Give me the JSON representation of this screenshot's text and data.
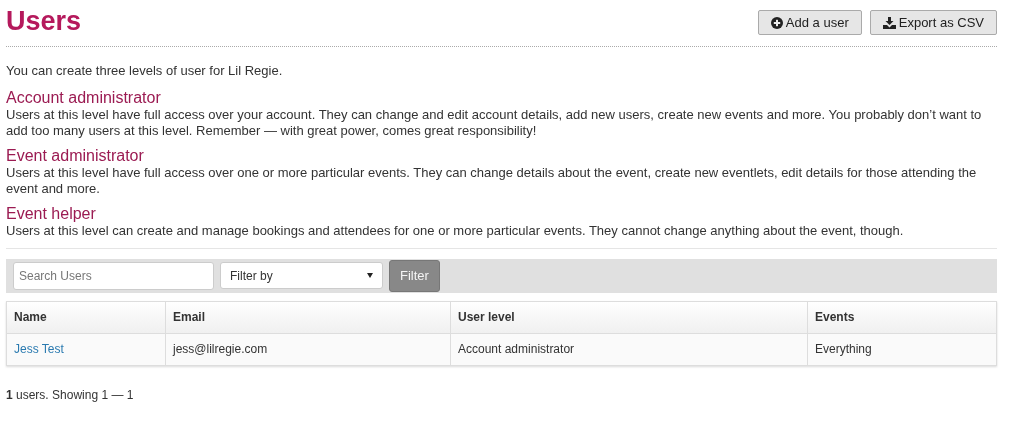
{
  "header": {
    "title": "Users",
    "buttons": [
      {
        "kind": "add",
        "label": "Add a user"
      },
      {
        "kind": "export",
        "label": "Export as CSV"
      }
    ]
  },
  "intro": "You can create three levels of user for Lil Regie.",
  "levels": [
    {
      "title": "Account administrator",
      "text": "Users at this level have full access over your account. They can change and edit account details, add new users, create new events and more. You probably don’t want to add too many users at this level. Remember — with great power, comes great responsibility!"
    },
    {
      "title": "Event administrator",
      "text": "Users at this level have full access over one or more particular events. They can change details about the event, create new eventlets, edit details for those attending the event and more."
    },
    {
      "title": "Event helper",
      "text": "Users at this level can create and manage bookings and attendees for one or more particular events. They cannot change anything about the event, though."
    }
  ],
  "filter_bar": {
    "search": {
      "placeholder": "Search Users"
    },
    "select": {
      "value": "Filter by"
    },
    "button": {
      "label": "Filter",
      "disabled": true
    }
  },
  "table": {
    "columns": [
      "Name",
      "Email",
      "User level",
      "Events"
    ],
    "rows": [
      {
        "name": "Jess Test",
        "email": "jess@lilregie.com",
        "user_level": "Account administrator",
        "events": "Everything"
      }
    ]
  },
  "footer": "**1** users. Showing 1 — 1"
}
